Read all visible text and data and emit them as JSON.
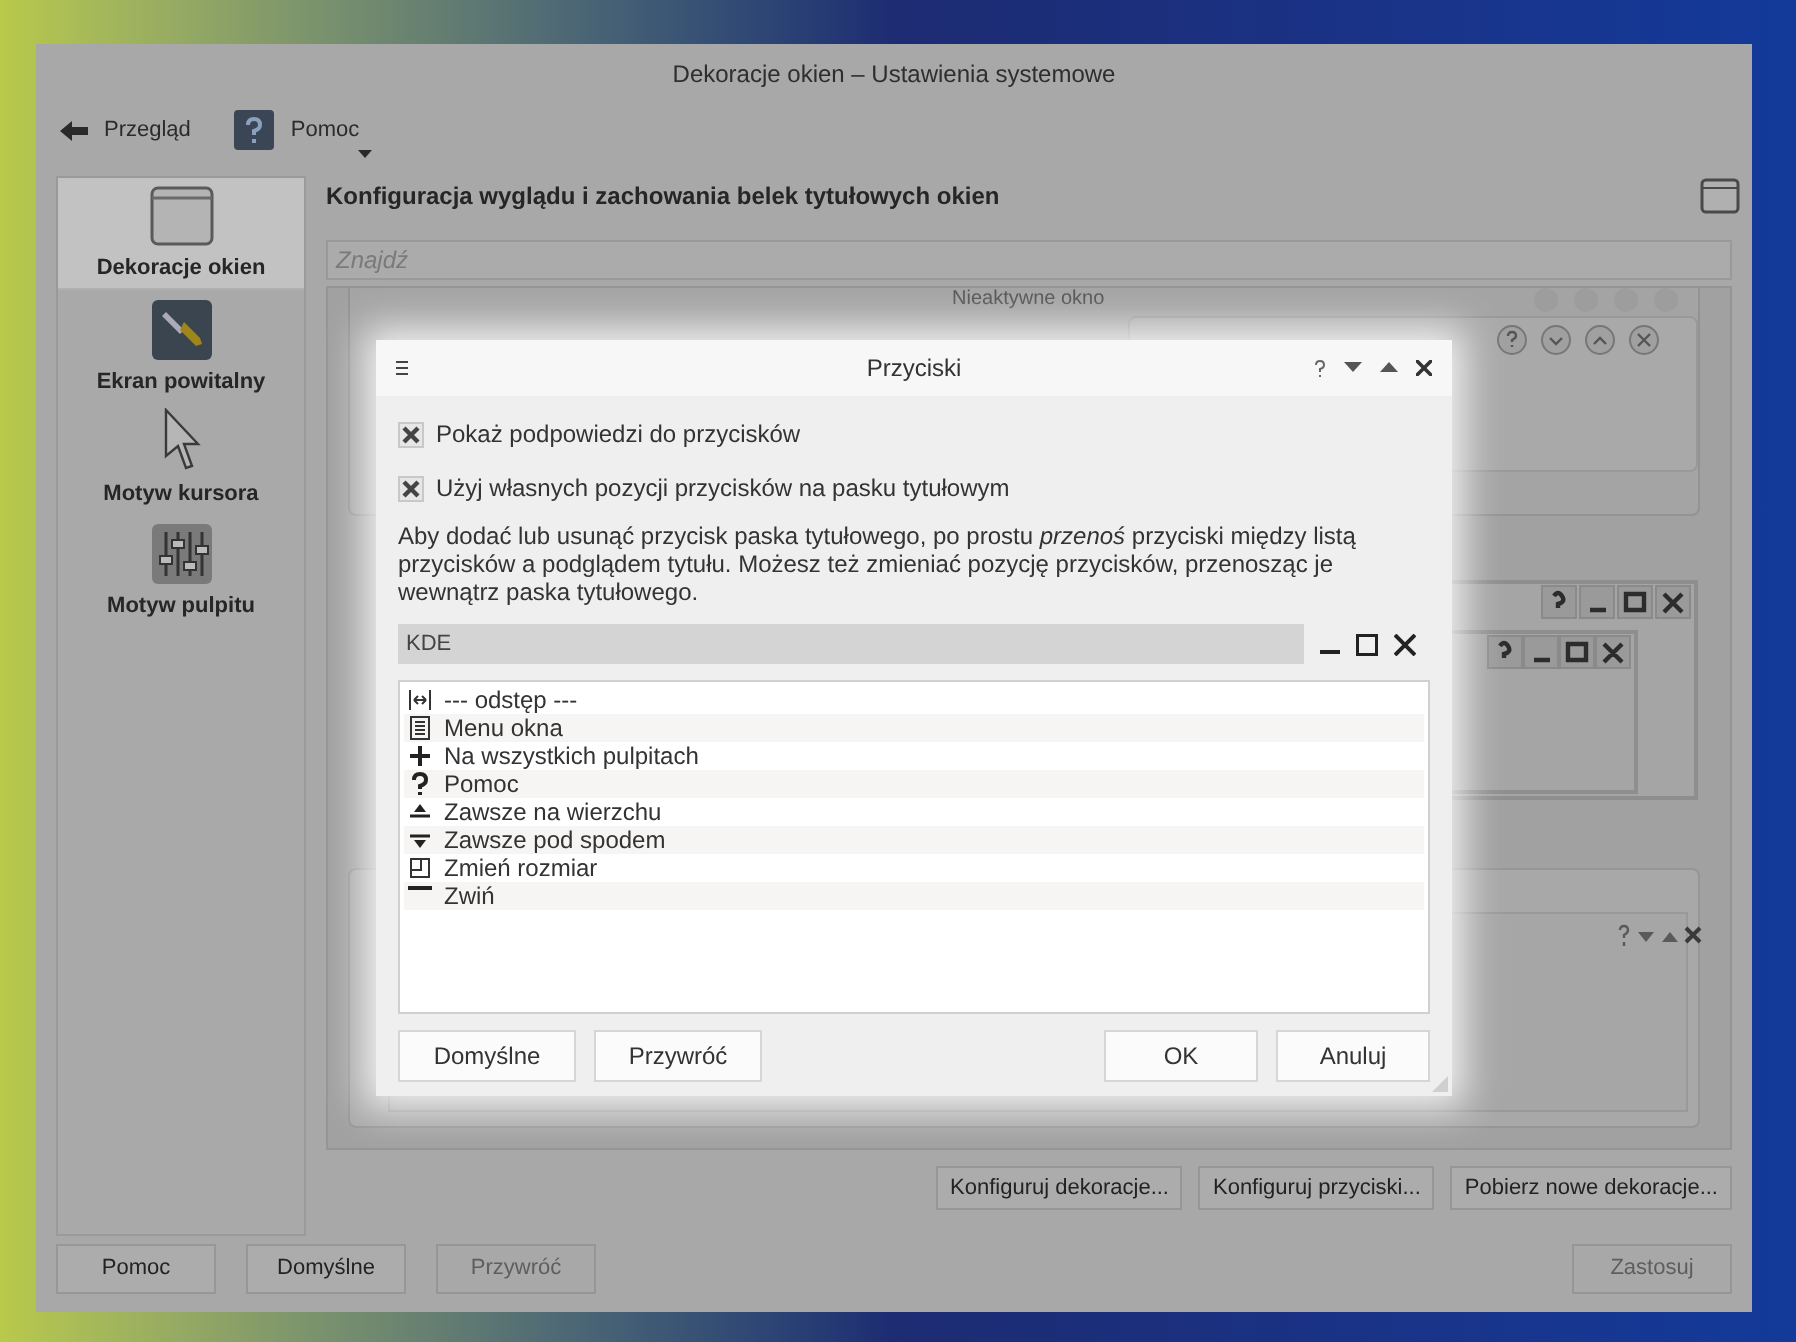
{
  "window": {
    "title": "Dekoracje okien – Ustawienia systemowe"
  },
  "toolbar": [
    {
      "kind": "back",
      "label": "Przegląd"
    },
    {
      "kind": "help",
      "label": "Pomoc"
    }
  ],
  "sidebar": {
    "items": [
      {
        "kind": "window",
        "label": "Dekoracje okien",
        "selected": true
      },
      {
        "kind": "wrench",
        "label": "Ekran powitalny",
        "selected": false
      },
      {
        "kind": "cursor",
        "label": "Motyw kursora",
        "selected": false
      },
      {
        "kind": "sliders",
        "label": "Motyw pulpitu",
        "selected": false
      }
    ]
  },
  "header": "Konfiguracja wyglądu i zachowania belek tytułowych okien",
  "search": {
    "placeholder": "Znajdź"
  },
  "preview": {
    "inactive_title": "Nieaktywne okno"
  },
  "action_buttons": [
    "Konfiguruj dekoracje...",
    "Konfiguruj przyciski...",
    "Pobierz nowe dekoracje..."
  ],
  "footer_buttons": [
    {
      "label": "Pomoc",
      "disabled": false
    },
    {
      "label": "Domyślne",
      "disabled": false
    },
    {
      "label": "Przywróć",
      "disabled": true
    },
    {
      "label": "Zastosuj",
      "disabled": true
    }
  ],
  "dialog": {
    "title": "Przyciski",
    "checkboxes": [
      {
        "label": "Pokaż podpowiedzi do przycisków",
        "checked": true
      },
      {
        "label": "Użyj własnych pozycji przycisków na pasku tytułowym",
        "checked": true
      }
    ],
    "description": "Aby dodać lub usunąć przycisk paska tytułowego, po prostu *przenoś* przyciski między listą przycisków a podglądem tytułu. Możesz też zmieniać pozycję przycisków, przenosząc je wewnątrz paska tytułowego.",
    "titlebar_preview": {
      "title": "KDE"
    },
    "buttons": [
      {
        "kind": "spacer",
        "label": "--- odstęp ---"
      },
      {
        "kind": "menu",
        "label": "Menu okna"
      },
      {
        "kind": "all_desktops",
        "label": "Na wszystkich pulpitach"
      },
      {
        "kind": "help",
        "label": "Pomoc"
      },
      {
        "kind": "keep_above",
        "label": "Zawsze na wierzchu"
      },
      {
        "kind": "keep_below",
        "label": "Zawsze pod spodem"
      },
      {
        "kind": "resize",
        "label": "Zmień rozmiar"
      },
      {
        "kind": "shade",
        "label": "Zwiń"
      }
    ],
    "left_buttons": [
      "Domyślne",
      "Przywróć"
    ],
    "right_buttons": [
      "OK",
      "Anuluj"
    ]
  }
}
